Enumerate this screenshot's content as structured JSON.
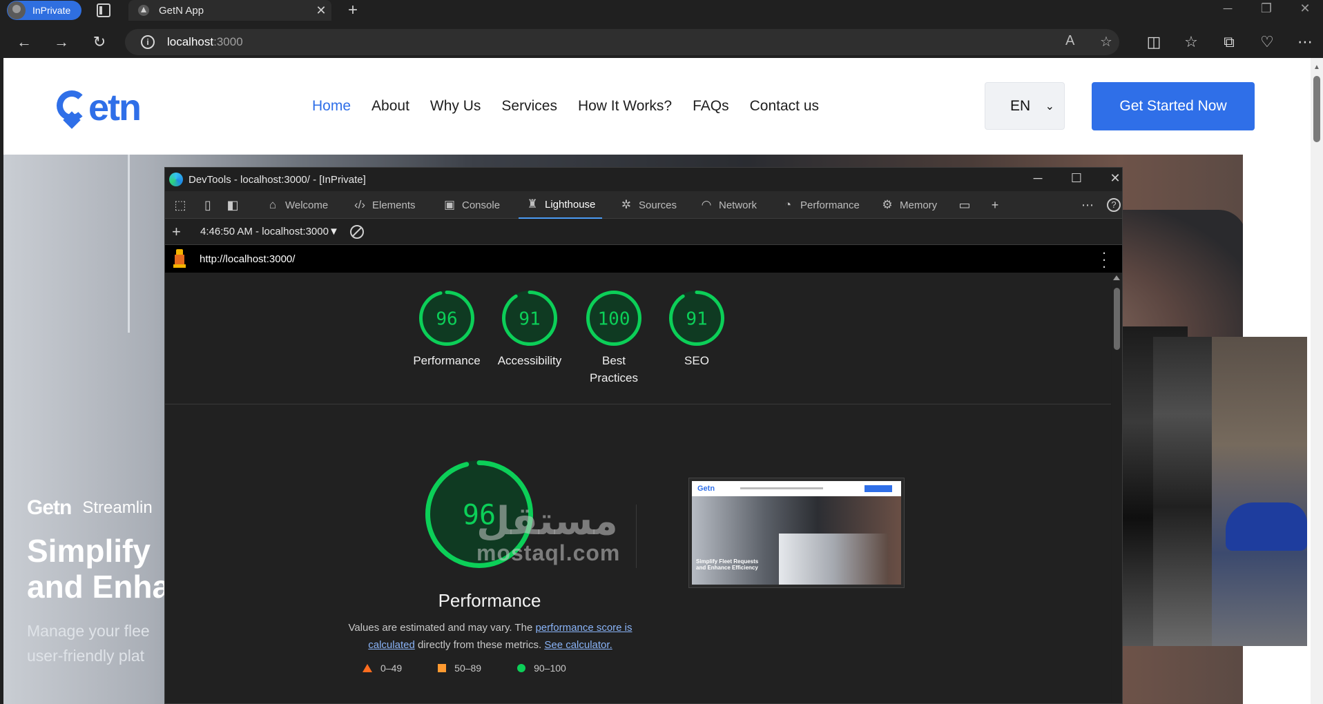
{
  "browser": {
    "inprivate_label": "InPrivate",
    "tab_title": "GetN App",
    "address_host": "localhost",
    "address_port": ":3000"
  },
  "site": {
    "logo_text": "Getn",
    "nav": [
      "Home",
      "About",
      "Why Us",
      "Services",
      "How It Works?",
      "FAQs",
      "Contact us"
    ],
    "active_nav": "Home",
    "language": "EN",
    "cta_label": "Get Started Now",
    "hero": {
      "brand": "Getn",
      "tagline": "Streamlin",
      "headline_1": "Simplify",
      "headline_2": "and Enha",
      "body_1": "Manage your flee",
      "body_2": "user-friendly plat"
    }
  },
  "devtools": {
    "window_title": "DevTools - localhost:3000/ - [InPrivate]",
    "tabs": [
      {
        "label": "Welcome",
        "icon": "home-icon"
      },
      {
        "label": "Elements",
        "icon": "code-icon"
      },
      {
        "label": "Console",
        "icon": "console-icon"
      },
      {
        "label": "Lighthouse",
        "icon": "lighthouse-icon"
      },
      {
        "label": "Sources",
        "icon": "bug-icon"
      },
      {
        "label": "Network",
        "icon": "wifi-icon"
      },
      {
        "label": "Performance",
        "icon": "gauge-icon"
      },
      {
        "label": "Memory",
        "icon": "chip-icon"
      }
    ],
    "active_tab": "Lighthouse",
    "report_label": "4:46:50 AM - localhost:3000",
    "audited_url": "http://localhost:3000/",
    "scores": [
      {
        "label": "Performance",
        "value": 96
      },
      {
        "label": "Accessibility",
        "value": 91
      },
      {
        "label": "Best Practices",
        "value": 100
      },
      {
        "label": "SEO",
        "value": 91
      }
    ],
    "main_score": {
      "label": "Performance",
      "value": 96
    },
    "disclaimer": {
      "text_1": "Values are estimated and may vary. The ",
      "link_1": "performance score is calculated",
      "text_2": " directly from these metrics. ",
      "link_2": "See calculator."
    },
    "legend": [
      {
        "range": "0–49",
        "color": "#ff6d1f"
      },
      {
        "range": "50–89",
        "color": "#ff9a30"
      },
      {
        "range": "90–100",
        "color": "#0ccf58"
      }
    ],
    "thumbnail": {
      "logo": "Getn",
      "headline": "Simplify Fleet Requests and Enhance Efficiency"
    },
    "colors": {
      "pass": "#0ccf58",
      "pass_bg": "#0f3a22",
      "accent": "#4b9cf5"
    }
  },
  "watermark": {
    "arabic": "مستقل",
    "latin": "mostaql.com"
  }
}
